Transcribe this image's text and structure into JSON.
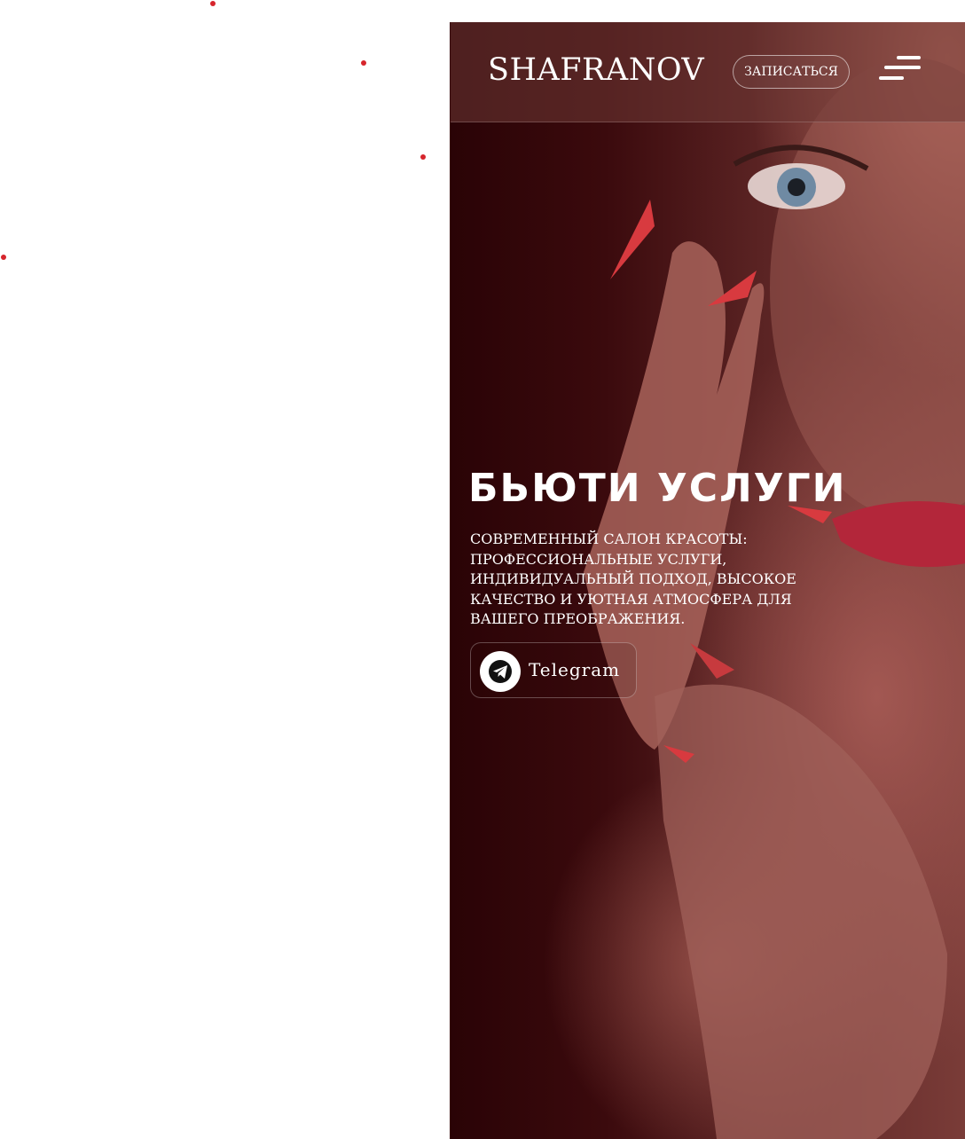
{
  "header": {
    "logo": "SHAFRANOV",
    "cta_label": "ЗАПИСАТЬСЯ"
  },
  "hero": {
    "title": "БЬЮТИ УСЛУГИ",
    "description": "Современный салон красоты: профессиональные услуги, индивидуальный подход, высокое качество и уютная атмосфера для вашего преображения.",
    "telegram_label": "Telegram"
  },
  "icons": {
    "menu": "hamburger-menu-icon",
    "telegram": "telegram-icon"
  },
  "colors": {
    "accent_dot": "#d6252c",
    "background_dark": "#3b0a0d",
    "text": "#ffffff"
  }
}
